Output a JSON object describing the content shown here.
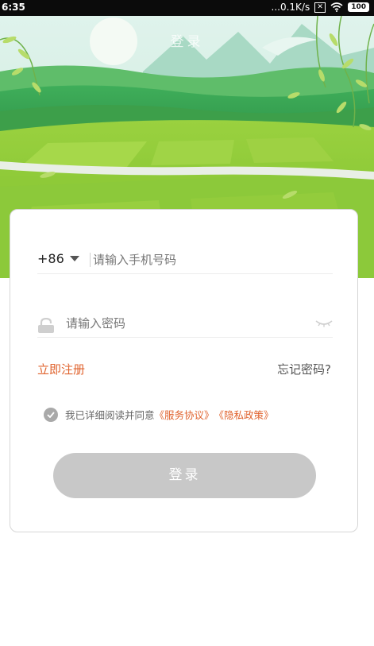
{
  "status_bar": {
    "time": "6:35",
    "network_speed": "...0.1K/s",
    "battery": "100",
    "icons": [
      "no-sim-icon",
      "wifi-icon",
      "battery-icon"
    ]
  },
  "page": {
    "title": "登录"
  },
  "login_form": {
    "country_code": "+86",
    "phone_placeholder": "请输入手机号码",
    "password_placeholder": "请输入密码",
    "register_label": "立即注册",
    "forgot_label": "忘记密码?",
    "agreement_prefix": "我已详细阅读并同意",
    "service_agreement": "《服务协议》",
    "privacy_policy": "《隐私政策》",
    "login_button": "登录"
  },
  "colors": {
    "accent": "#e0632e",
    "disabled_button": "#c8c8c8",
    "field_green": "#8cc93a"
  }
}
